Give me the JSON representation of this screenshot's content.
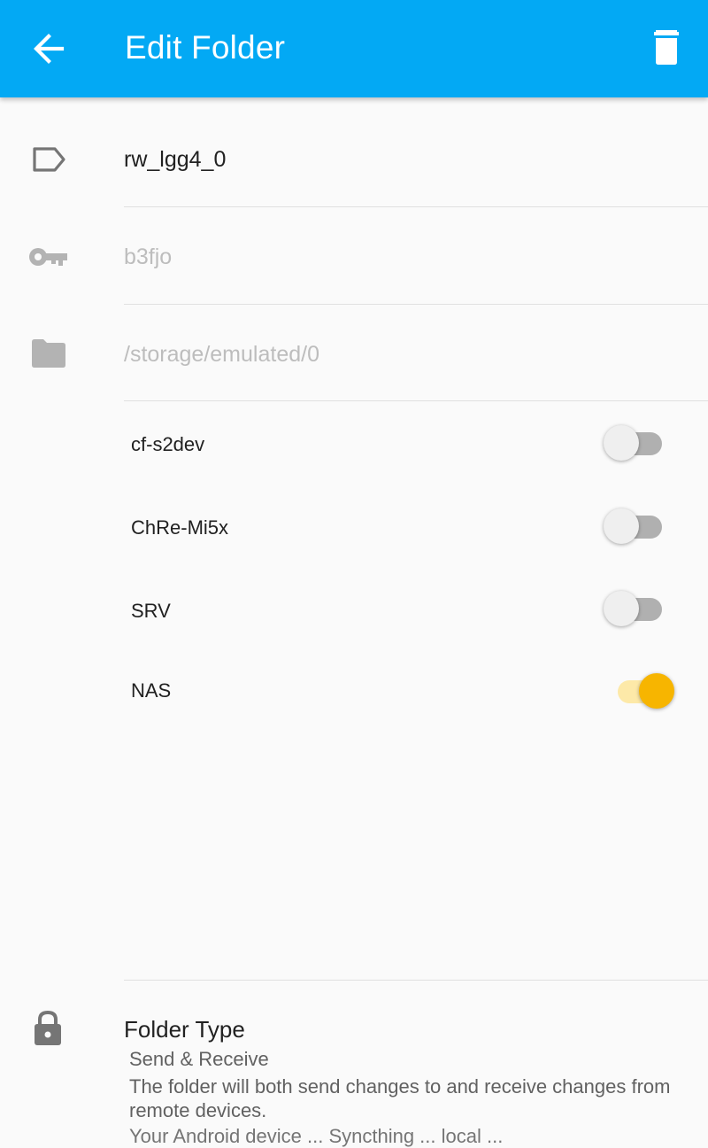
{
  "appbar": {
    "title": "Edit Folder",
    "back_icon": "arrow-left-icon",
    "delete_icon": "trash-icon",
    "background": "#03a9f4"
  },
  "fields": {
    "label": {
      "value": "rw_lgg4_0",
      "icon": "label-tag-icon"
    },
    "id": {
      "placeholder": "b3fjo",
      "icon": "key-icon"
    },
    "path": {
      "placeholder": "/storage/emulated/0",
      "icon": "folder-icon"
    }
  },
  "devices": [
    {
      "name": "cf-s2dev",
      "enabled": false
    },
    {
      "name": "ChRe-Mi5x",
      "enabled": false
    },
    {
      "name": "SRV",
      "enabled": false
    },
    {
      "name": "NAS",
      "enabled": true
    }
  ],
  "folder_type": {
    "icon": "lock-icon",
    "title": "Folder Type",
    "value": "Send & Receive",
    "description": "The folder will both send changes to and receive changes from remote devices.",
    "clipped_text": "Your Android device ... Syncthing ... local ... "
  },
  "colors": {
    "accent": "#f7b500",
    "accent_track": "#fde9a8",
    "icon_gray": "#9e9e9e"
  }
}
